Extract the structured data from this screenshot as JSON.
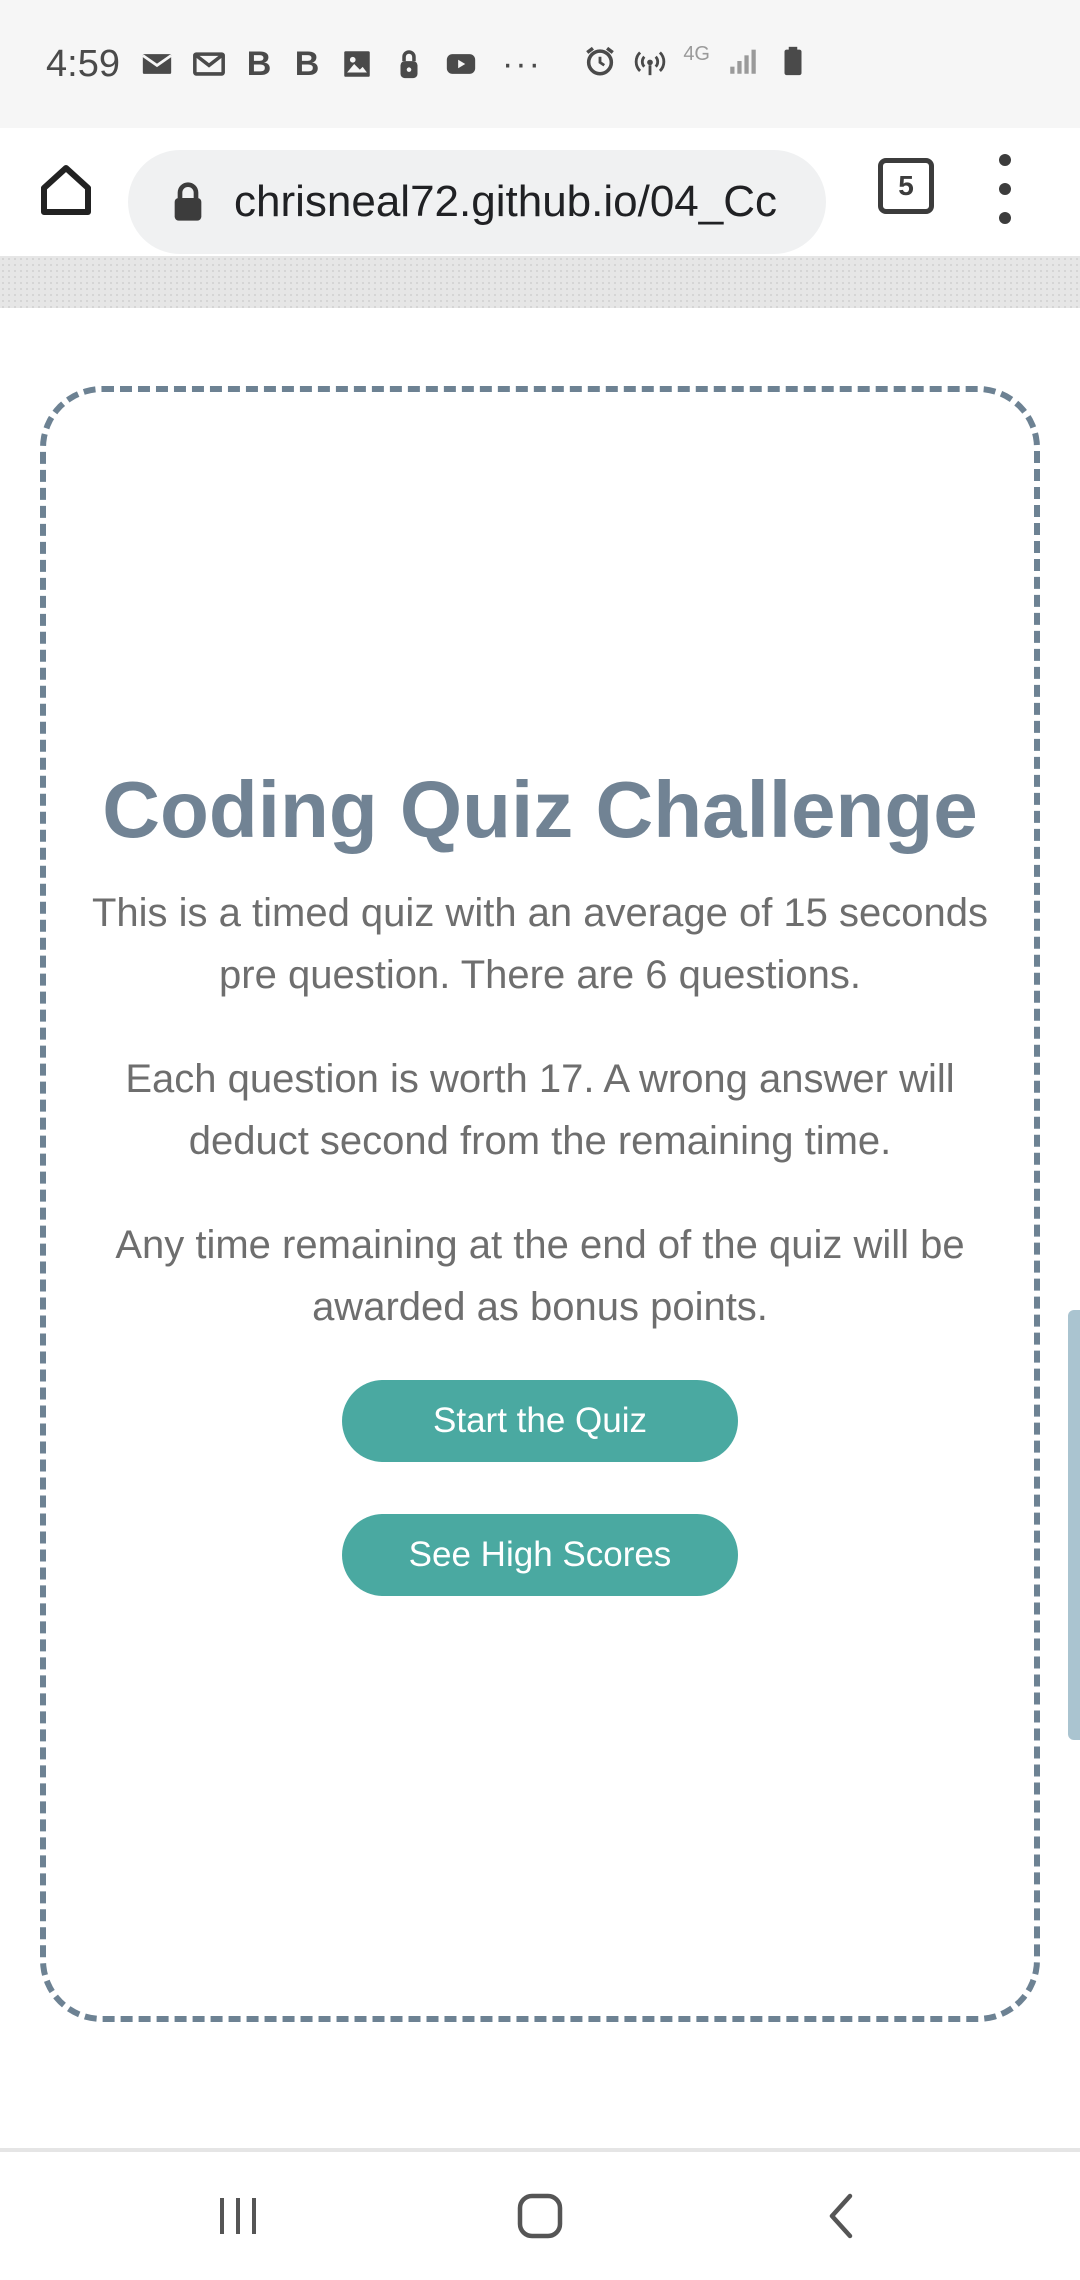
{
  "status_bar": {
    "time": "4:59",
    "left_icons": [
      "mail-icon",
      "gmail-icon",
      "bold-b-icon",
      "bold-b-icon",
      "image-icon",
      "lock-notification-icon",
      "youtube-icon"
    ],
    "bold_letter": "B",
    "more": "···",
    "right_icons": [
      "alarm-icon",
      "hotspot-icon",
      "network-4g-icon",
      "signal-icon",
      "battery-icon"
    ],
    "network_label": "4G"
  },
  "browser": {
    "url": "chrisneal72.github.io/04_Cc",
    "tab_count": "5"
  },
  "quiz": {
    "title": "Coding Quiz Challenge",
    "paragraph1": "This is a timed quiz with an average of 15 seconds pre question. There are 6 questions.",
    "paragraph2": "Each question is worth 17. A wrong answer will deduct second from the remaining time.",
    "paragraph3": "Any time remaining at the end of the quiz will be awarded as bonus points.",
    "start_button": "Start the Quiz",
    "scores_button": "See High Scores"
  },
  "colors": {
    "title": "#718394",
    "border": "#6d8293",
    "button": "#4aa9a1",
    "text": "#6e6e6e"
  },
  "nav": {
    "icons": [
      "recent-apps-icon",
      "home-icon",
      "back-icon"
    ]
  }
}
